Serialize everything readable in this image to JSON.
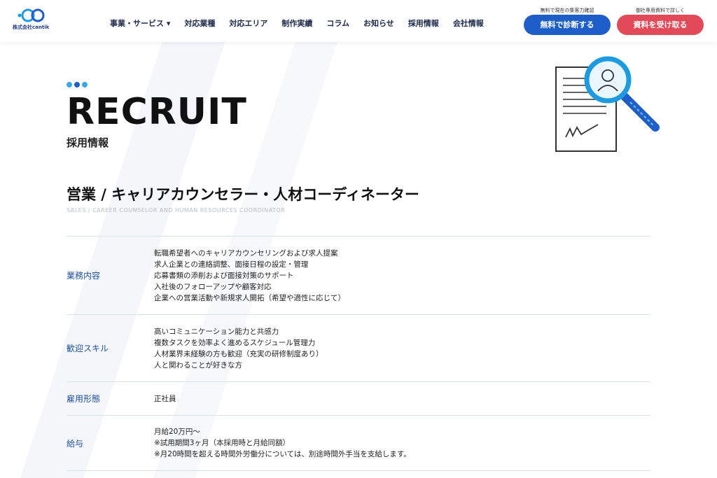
{
  "brand": {
    "logo_text": "株式会社cantik",
    "colors": {
      "primary": "#1d5ec9",
      "accent": "#e24a5a",
      "label": "#1d4f9a",
      "logo": "#1e9be0"
    }
  },
  "nav": {
    "items": [
      {
        "label": "事業・サービス ▾"
      },
      {
        "label": "対応業種"
      },
      {
        "label": "対応エリア"
      },
      {
        "label": "制作実績"
      },
      {
        "label": "コラム"
      },
      {
        "label": "お知らせ"
      },
      {
        "label": "採用情報"
      },
      {
        "label": "会社情報"
      }
    ]
  },
  "cta": {
    "diagnosis": {
      "caption": "無料で現在の集客力確認",
      "label": "無料で診断する"
    },
    "documents": {
      "caption": "御社専用資料で詳しく",
      "label": "資料を受け取る"
    }
  },
  "hero": {
    "title": "RECRUIT",
    "subtitle": "採用情報",
    "dots_colors": [
      "#3aa8e8",
      "#1d5ec9",
      "#3aa8e8"
    ],
    "illustration_icon": "document-magnifier-icon"
  },
  "job": {
    "title": "営業 / キャリアカウンセラー・人材コーディネーター",
    "subtitle": "SALES / CAREER COUNSELOR AND HUMAN RESOURCES COORDINATOR",
    "rows": [
      {
        "label": "業務内容",
        "lines": [
          "転職希望者へのキャリアカウンセリングおよび求人提案",
          "求人企業との連絡調整、面接日程の設定・管理",
          "応募書類の添削および面接対策のサポート",
          "入社後のフォローアップや顧客対応",
          "企業への営業活動や新規求人開拓（希望や適性に応じて）"
        ]
      },
      {
        "label": "歓迎スキル",
        "lines": [
          "高いコミュニケーション能力と共感力",
          "複数タスクを効率よく進めるスケジュール管理力",
          "人材業界未経験の方も歓迎（充実の研修制度あり）",
          "人と関わることが好きな方"
        ]
      },
      {
        "label": "雇用形態",
        "lines": [
          "正社員"
        ]
      },
      {
        "label": "給与",
        "lines": [
          "月給20万円～",
          "※試用期間3ヶ月（本採用時と月給同額）",
          "※月20時間を超える時間外労働分については、別途時間外手当を支給します。"
        ]
      }
    ]
  }
}
